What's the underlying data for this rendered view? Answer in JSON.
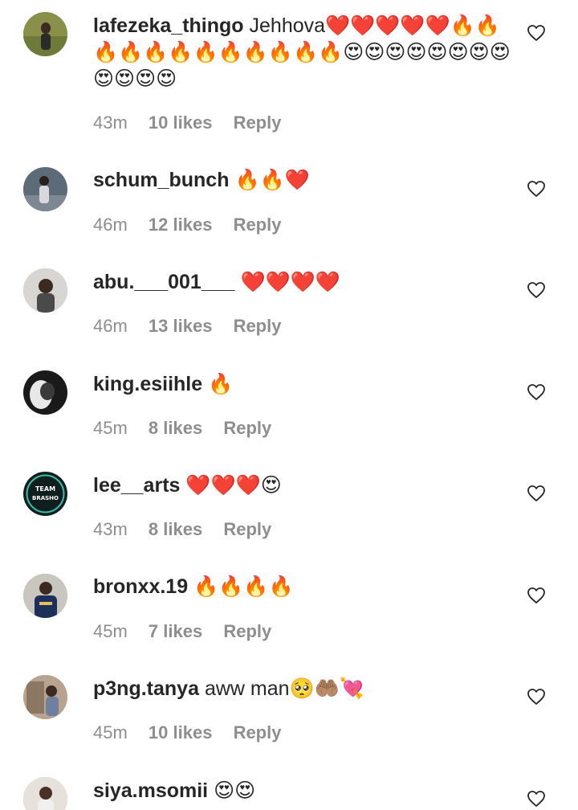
{
  "comments": [
    {
      "username": "lafezeka_thingo",
      "text": "Jehhova",
      "emojis": "❤️❤️❤️❤️❤️🔥🔥🔥🔥🔥🔥🔥🔥🔥🔥🔥🔥😍😍😍😍😍😍😍😍😍😍😍😍",
      "time": "43m",
      "likes": "10 likes",
      "reply": "Reply"
    },
    {
      "username": "schum_bunch",
      "text": "",
      "emojis": "🔥🔥❤️",
      "time": "46m",
      "likes": "12 likes",
      "reply": "Reply"
    },
    {
      "username": "abu.___001___",
      "text": "",
      "emojis": "❤️❤️❤️❤️",
      "time": "46m",
      "likes": "13 likes",
      "reply": "Reply"
    },
    {
      "username": "king.esiihle",
      "text": "",
      "emojis": "🔥",
      "time": "45m",
      "likes": "8 likes",
      "reply": "Reply"
    },
    {
      "username": "lee__arts",
      "text": "",
      "emojis": "❤️❤️❤️😍",
      "time": "43m",
      "likes": "8 likes",
      "reply": "Reply",
      "avatar_text": "TEAM BRASHO"
    },
    {
      "username": "bronxx.19",
      "text": "",
      "emojis": "🔥🔥🔥🔥",
      "time": "45m",
      "likes": "7 likes",
      "reply": "Reply"
    },
    {
      "username": "p3ng.tanya",
      "text": "aww man",
      "emojis": "🥺🤲🏽💘",
      "time": "45m",
      "likes": "10 likes",
      "reply": "Reply"
    },
    {
      "username": "siya.msomii",
      "text": "",
      "emojis": "😍😍",
      "time": "",
      "likes": "",
      "reply": ""
    }
  ],
  "icons": {
    "like": "heart-outline-icon"
  },
  "colors": {
    "text": "#262626",
    "meta": "#8e8e8e",
    "background": "#ffffff"
  }
}
